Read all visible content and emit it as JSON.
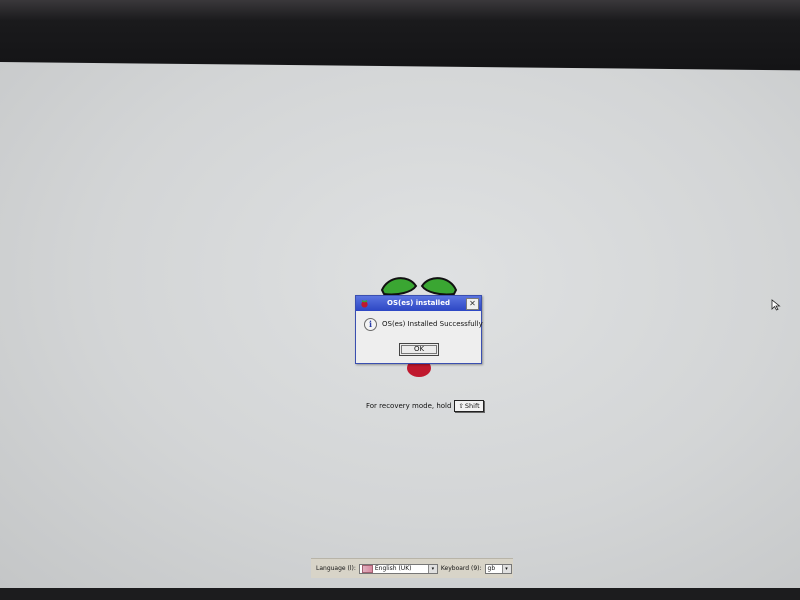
{
  "dialog": {
    "title": "OS(es) installed",
    "message": "OS(es) Installed Successfully",
    "ok_label": "OK",
    "close_glyph": "✕",
    "info_glyph": "i"
  },
  "recovery": {
    "text": "For recovery mode, hold",
    "key_glyph": "⇧",
    "key_label": "Shift"
  },
  "bottom_bar": {
    "language_label": "Language (l):",
    "language_value": "English (UK)",
    "keyboard_label": "Keyboard (9):",
    "keyboard_value": "gb",
    "dropdown_glyph": "▾"
  },
  "colors": {
    "title_bar": "#2c46c4",
    "leaf_green": "#3aa632",
    "berry_red": "#c0182e"
  },
  "icons": [
    "raspberry-logo",
    "info-icon",
    "close-icon",
    "shift-arrow-icon",
    "uk-flag-icon",
    "mouse-cursor-icon"
  ]
}
